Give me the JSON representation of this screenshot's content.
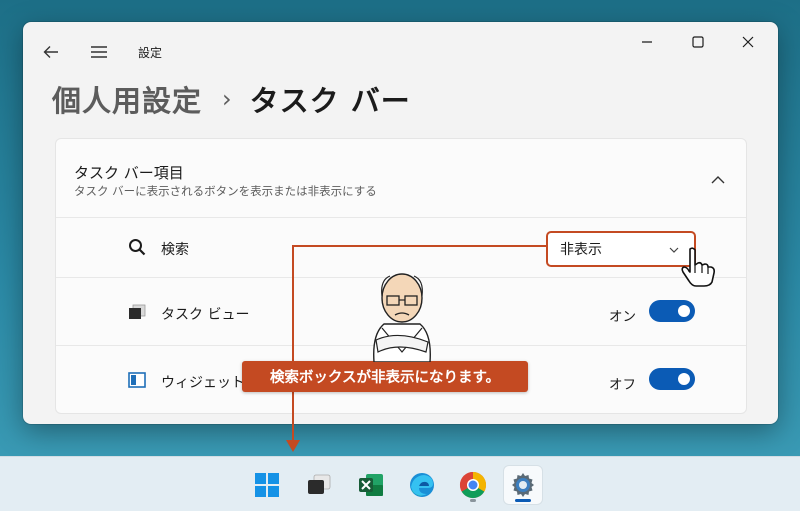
{
  "window": {
    "app_title": "設定",
    "breadcrumb_parent": "個人用設定",
    "breadcrumb_separator": "›",
    "breadcrumb_current": "タスク バー"
  },
  "panel": {
    "title": "タスク バー項目",
    "description": "タスク バーに表示されるボタンを表示または非表示にする",
    "rows": [
      {
        "label": "検索",
        "control": "dropdown",
        "value": "非表示",
        "icon": "search-icon"
      },
      {
        "label": "タスク ビュー",
        "control": "toggle",
        "state_label": "オン",
        "on": true,
        "icon": "task-view-icon"
      },
      {
        "label": "ウィジェット",
        "control": "toggle",
        "state_label": "オフ",
        "on": true,
        "icon": "widgets-icon"
      }
    ]
  },
  "callout": {
    "text": "検索ボックスが非表示になります。",
    "color": "#c44a22"
  },
  "taskbar": {
    "apps": [
      {
        "name": "start",
        "icon": "windows-start-icon"
      },
      {
        "name": "task-view",
        "icon": "task-view-icon"
      },
      {
        "name": "excel",
        "icon": "excel-icon"
      },
      {
        "name": "edge",
        "icon": "edge-icon"
      },
      {
        "name": "chrome",
        "icon": "chrome-icon"
      },
      {
        "name": "settings",
        "icon": "settings-gear-icon",
        "active": true
      }
    ]
  },
  "colors": {
    "accent": "#0b5bb5",
    "callout": "#c44a22",
    "desktop": "#2b8aa6"
  }
}
